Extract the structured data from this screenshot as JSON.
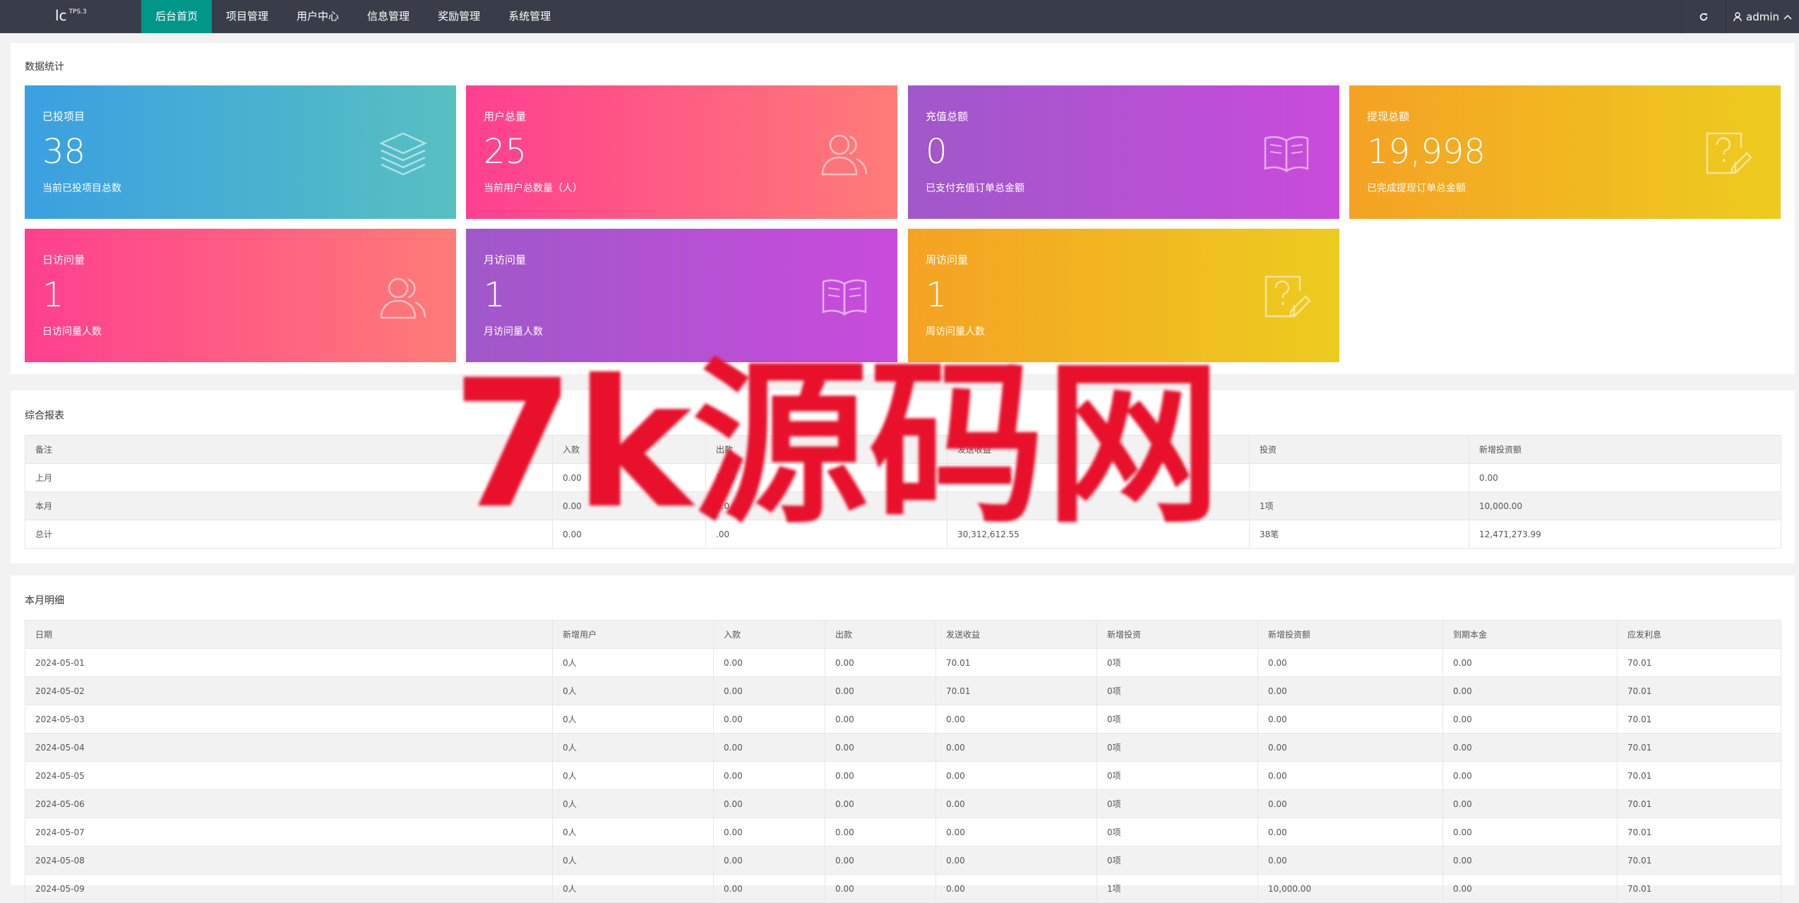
{
  "app": {
    "logo": "lc",
    "version": "TPS.3"
  },
  "nav": {
    "items": [
      "后台首页",
      "项目管理",
      "用户中心",
      "信息管理",
      "奖励管理",
      "系统管理"
    ],
    "active_index": 0,
    "user": "admin",
    "refresh_icon": "refresh-icon",
    "user_icon": "user-icon",
    "chevron_icon": "chevron-up-icon"
  },
  "stats": {
    "title": "数据统计",
    "cards": [
      {
        "title": "已投项目",
        "value": "38",
        "desc": "当前已投项目总数",
        "icon": "layers-icon",
        "colors": [
          "#3aa0e1",
          "#57c0c1"
        ]
      },
      {
        "title": "用户总量",
        "value": "25",
        "desc": "当前用户总数量（人）",
        "icon": "users-icon",
        "colors": [
          "#ff3f8f",
          "#ff7c77"
        ]
      },
      {
        "title": "充值总额",
        "value": "0",
        "desc": "已支付充值订单总金额",
        "icon": "book-icon",
        "colors": [
          "#9f58c9",
          "#c94bdc"
        ]
      },
      {
        "title": "提现总额",
        "value": "19,998",
        "desc": "已完成提现订单总金额",
        "icon": "question-edit-icon",
        "colors": [
          "#f5a223",
          "#edcc1e"
        ]
      },
      {
        "title": "日访问量",
        "value": "1",
        "desc": "日访问量人数",
        "icon": "users-icon",
        "colors": [
          "#ff3f8f",
          "#ff7c77"
        ]
      },
      {
        "title": "月访问量",
        "value": "1",
        "desc": "月访问量人数",
        "icon": "book-icon",
        "colors": [
          "#9f58c9",
          "#c94bdc"
        ]
      },
      {
        "title": "周访问量",
        "value": "1",
        "desc": "周访问量人数",
        "icon": "question-edit-icon",
        "colors": [
          "#f5a223",
          "#edcc1e"
        ]
      }
    ]
  },
  "report": {
    "title": "综合报表",
    "headers": [
      "备注",
      "入款",
      "出款",
      "发送收益",
      "投资",
      "新增投资额"
    ],
    "rows": [
      [
        "上月",
        "0.00",
        "19,9",
        "30,156,  5.38",
        "",
        "0.00"
      ],
      [
        "本月",
        "0.00",
        "0.0",
        "",
        "1项",
        "10,000.00"
      ],
      [
        "总计",
        "0.00",
        ".00",
        "30,312,612.55",
        "38笔",
        "12,471,273.99"
      ]
    ]
  },
  "monthly": {
    "title": "本月明细",
    "headers": [
      "日期",
      "新增用户",
      "入款",
      "出款",
      "发送收益",
      "新增投资",
      "新增投资额",
      "到期本金",
      "应发利息"
    ],
    "rows": [
      [
        "2024-05-01",
        "0人",
        "0.00",
        "0.00",
        "70.01",
        "0项",
        "0.00",
        "0.00",
        "70.01"
      ],
      [
        "2024-05-02",
        "0人",
        "0.00",
        "0.00",
        "70.01",
        "0项",
        "0.00",
        "0.00",
        "70.01"
      ],
      [
        "2024-05-03",
        "0人",
        "0.00",
        "0.00",
        "0.00",
        "0项",
        "0.00",
        "0.00",
        "70.01"
      ],
      [
        "2024-05-04",
        "0人",
        "0.00",
        "0.00",
        "0.00",
        "0项",
        "0.00",
        "0.00",
        "70.01"
      ],
      [
        "2024-05-05",
        "0人",
        "0.00",
        "0.00",
        "0.00",
        "0项",
        "0.00",
        "0.00",
        "70.01"
      ],
      [
        "2024-05-06",
        "0人",
        "0.00",
        "0.00",
        "0.00",
        "0项",
        "0.00",
        "0.00",
        "70.01"
      ],
      [
        "2024-05-07",
        "0人",
        "0.00",
        "0.00",
        "0.00",
        "0项",
        "0.00",
        "0.00",
        "70.01"
      ],
      [
        "2024-05-08",
        "0人",
        "0.00",
        "0.00",
        "0.00",
        "0项",
        "0.00",
        "0.00",
        "70.01"
      ],
      [
        "2024-05-09",
        "0人",
        "0.00",
        "0.00",
        "0.00",
        "1项",
        "10,000.00",
        "0.00",
        "70.01"
      ]
    ]
  },
  "watermark": "7k源码网"
}
